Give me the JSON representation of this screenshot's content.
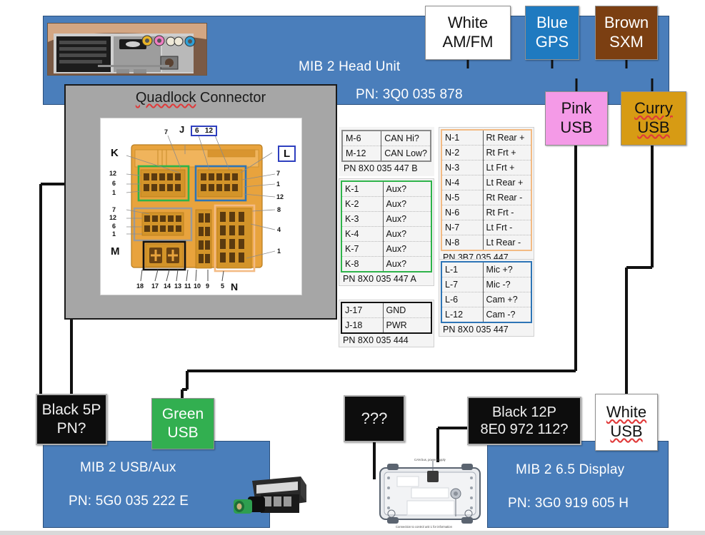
{
  "panels": {
    "head_unit": {
      "title": "MIB 2 Head Unit",
      "pn": "PN: 3Q0 035 878"
    },
    "usb_aux": {
      "title": "MIB 2 USB/Aux",
      "pn": "PN: 5G0 035 222 E"
    },
    "display": {
      "title": "MIB 2 6.5 Display",
      "pn": "PN: 3G0 919 605 H"
    }
  },
  "quadlock": {
    "title_word_misspelled": "Quadlock",
    "title_rest": " Connector",
    "labels": {
      "J": "J",
      "K": "K",
      "L": "L",
      "M": "M",
      "N": "N",
      "pin6": "6",
      "pin12": "12",
      "left_top": [
        "12",
        "6",
        "1"
      ],
      "left_mid": [
        "7",
        "12",
        "6",
        "1"
      ],
      "top_callout": "7",
      "right_top": [
        "7",
        "1",
        "12"
      ],
      "right_mid": [
        "8",
        "4",
        "1"
      ],
      "bottom_row": [
        "18",
        "17",
        "14",
        "13",
        "11",
        "10",
        "9",
        "5"
      ]
    }
  },
  "chips": {
    "white_amfm": {
      "line1": "White",
      "line2": "AM/FM",
      "color": "#ffffff"
    },
    "blue_gps": {
      "line1": "Blue",
      "line2": "GPS",
      "color": "#1f7ac0"
    },
    "brown_sxm": {
      "line1": "Brown",
      "line2": "SXM",
      "color": "#7b3f12"
    },
    "pink_usb": {
      "line1": "Pink",
      "line2": "USB",
      "color": "#f49ae7"
    },
    "curry_usb": {
      "line1": "Curry",
      "line2": "USB",
      "color": "#d79b14"
    },
    "black_5p": {
      "line1": "Black 5P",
      "line2": "PN?",
      "color": "#0d0d0d"
    },
    "green_usb": {
      "line1": "Green",
      "line2": "USB",
      "color": "#32af50"
    },
    "unknown": {
      "line1": "???",
      "line2": "",
      "color": "#0d0d0d"
    },
    "black_12p": {
      "line1": "Black 12P",
      "line2": "8E0 972 112?",
      "color": "#0d0d0d"
    },
    "white_usb": {
      "line1": "White",
      "line2": "USB",
      "color": "#ffffff"
    }
  },
  "tables": {
    "m": {
      "rows": [
        [
          "M-6",
          "CAN Hi?"
        ],
        [
          "M-12",
          "CAN Low?"
        ]
      ],
      "pn": "PN 8X0 035 447 B"
    },
    "k": {
      "rows": [
        [
          "K-1",
          "Aux?"
        ],
        [
          "K-2",
          "Aux?"
        ],
        [
          "K-3",
          "Aux?"
        ],
        [
          "K-4",
          "Aux?"
        ],
        [
          "K-7",
          "Aux?"
        ],
        [
          "K-8",
          "Aux?"
        ]
      ],
      "pn": "PN 8X0 035 447 A"
    },
    "j": {
      "rows": [
        [
          "J-17",
          "GND"
        ],
        [
          "J-18",
          "PWR"
        ]
      ],
      "pn": "PN  8X0 035 444"
    },
    "n": {
      "rows": [
        [
          "N-1",
          "Rt Rear +"
        ],
        [
          "N-2",
          "Rt Frt +"
        ],
        [
          "N-3",
          "Lt Frt +"
        ],
        [
          "N-4",
          "Lt Rear +"
        ],
        [
          "N-5",
          "Rt Rear -"
        ],
        [
          "N-6",
          "Rt Frt -"
        ],
        [
          "N-7",
          "Lt Frt -"
        ],
        [
          "N-8",
          "Lt Rear -"
        ]
      ],
      "pn": "PN 3B7 035 447"
    },
    "l": {
      "rows": [
        [
          "L-1",
          "Mic +?"
        ],
        [
          "L-7",
          "Mic -?"
        ],
        [
          "L-6",
          "Cam +?"
        ],
        [
          "L-12",
          "Cam -?"
        ]
      ],
      "pn": "PN 8X0 035 447"
    }
  },
  "display_photo_captions": {
    "top": "CAN bus, power supply",
    "bottom": "Connection to control unit 1 for information"
  },
  "colors": {
    "panel_blue": "#4a7ebb",
    "quadlock_gray": "#a6a6a6",
    "frame_green": "#2eb34a",
    "frame_blue": "#2e75b6",
    "frame_orange": "#f3bb84",
    "frame_gray": "#8a8a8a",
    "frame_black": "#111111",
    "connector_orange": "#e8a33d"
  }
}
